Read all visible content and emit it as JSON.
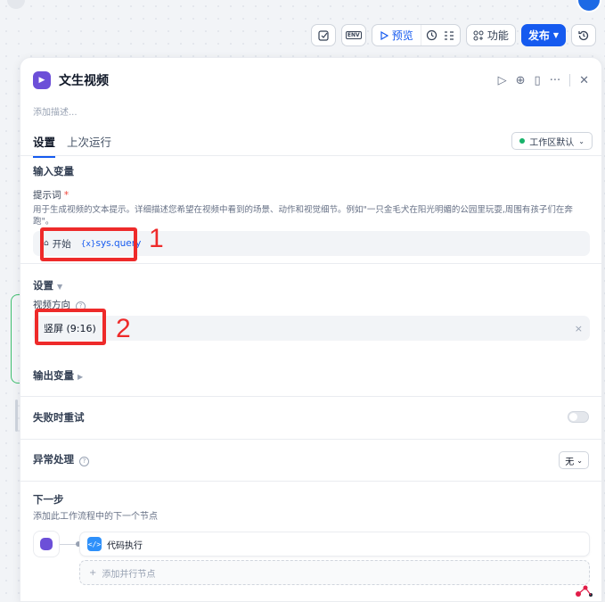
{
  "toolbar": {
    "preview_label": "预览",
    "features_label": "功能",
    "publish_label": "发布",
    "env_label": "ENV"
  },
  "panel": {
    "title": "文生视频",
    "description_placeholder": "添加描述...",
    "tabs": [
      {
        "label": "设置",
        "active": true
      },
      {
        "label": "上次运行",
        "active": false
      }
    ],
    "workspace": {
      "label": "工作区默认",
      "status_color": "#17b26a"
    },
    "inputs": {
      "section_title": "输入变量",
      "prompt_label": "提示词",
      "required_mark": "*",
      "prompt_hint": "用于生成视频的文本提示。详细描述您希望在视频中看到的场景、动作和视觉细节。例如\"一只金毛犬在阳光明媚的公园里玩耍,周围有孩子们在奔跑\"。",
      "var_source": "开始",
      "var_icon": "{x}",
      "var_name": "sys.query"
    },
    "settings": {
      "section_title": "设置",
      "orientation_label": "视频方向",
      "help_icon": "?",
      "orientation_value": "竖屏 (9:16)",
      "clear_icon": "×"
    },
    "outputs": {
      "section_title": "输出变量"
    },
    "retry": {
      "label": "失败时重试",
      "enabled": false
    },
    "error_handling": {
      "label": "异常处理",
      "value": "无"
    },
    "next_step": {
      "title": "下一步",
      "description": "添加此工作流程中的下一个节点",
      "next_node_label": "代码执行",
      "add_parallel_label": "添加并行节点",
      "add_icon": "+"
    }
  },
  "annotations": [
    {
      "number": "1",
      "color": "#ee2a2a"
    },
    {
      "number": "2",
      "color": "#ee2a2a"
    }
  ]
}
